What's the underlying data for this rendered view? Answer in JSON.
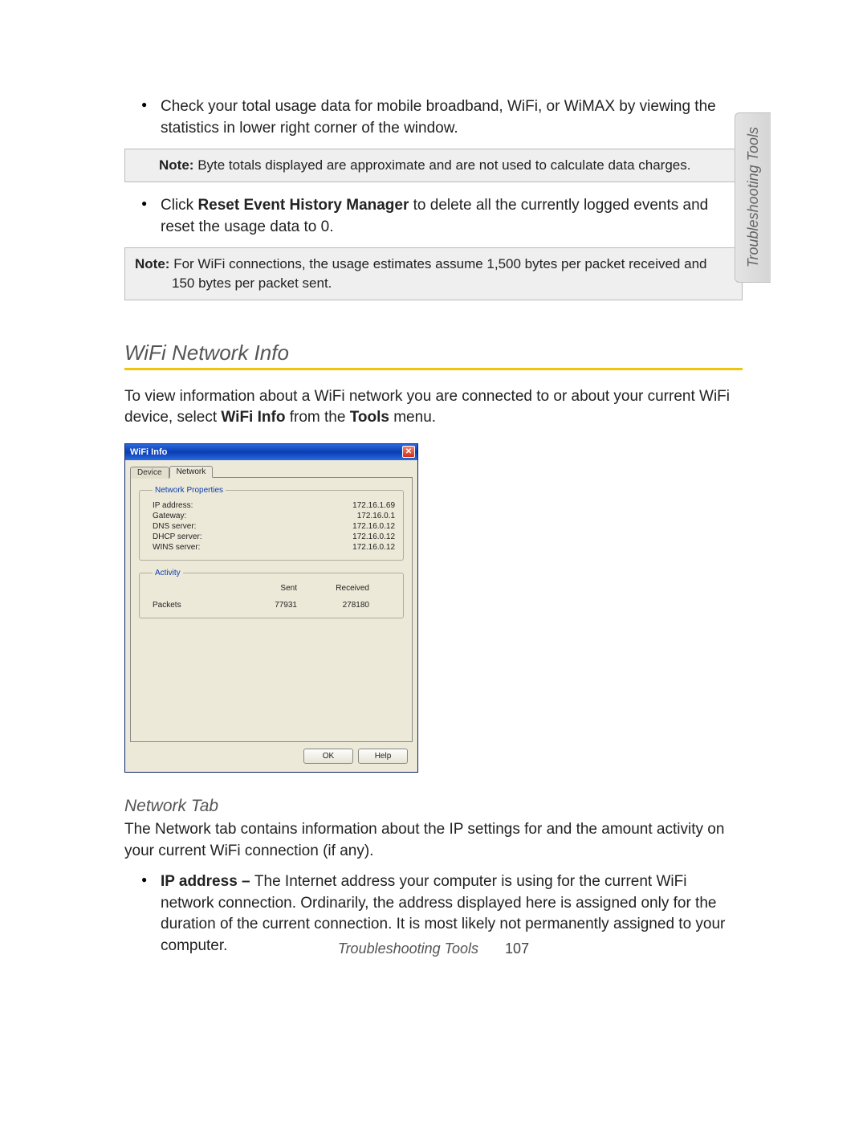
{
  "side_tab": "Troubleshooting Tools",
  "bullets_top": [
    "Check your total usage data for mobile broadband, WiFi, or WiMAX by viewing the statistics in lower right corner of the window."
  ],
  "note1": {
    "label": "Note:",
    "text": "Byte totals displayed are approximate and are not used to calculate data charges."
  },
  "bullet_click": {
    "pre": "Click ",
    "bold": "Reset Event History Manager",
    "post": " to delete all the currently logged events and reset the usage data to 0."
  },
  "note2": {
    "label": "Note:",
    "text": "For WiFi connections, the usage estimates assume 1,500 bytes per packet received and 150 bytes per packet sent."
  },
  "section_heading": "WiFi Network Info",
  "intro": {
    "pre": "To view information about a WiFi network you are connected to or about your current WiFi device, select ",
    "b1": "WiFi Info",
    "mid": " from the ",
    "b2": "Tools",
    "post": " menu."
  },
  "dialog": {
    "title": "WiFi Info",
    "tabs": {
      "device": "Device",
      "network": "Network"
    },
    "network_properties_legend": "Network Properties",
    "props": {
      "ip_label": "IP address:",
      "ip_val": "172.16.1.69",
      "gw_label": "Gateway:",
      "gw_val": "172.16.0.1",
      "dns_label": "DNS server:",
      "dns_val": "172.16.0.12",
      "dhcp_label": "DHCP server:",
      "dhcp_val": "172.16.0.12",
      "wins_label": "WINS server:",
      "wins_val": "172.16.0.12"
    },
    "activity_legend": "Activity",
    "activity": {
      "sent_header": "Sent",
      "recv_header": "Received",
      "row_label": "Packets",
      "sent_val": "77931",
      "recv_val": "278180"
    },
    "ok": "OK",
    "help": "Help"
  },
  "sub_heading": "Network Tab",
  "sub_para": "The Network tab contains information about the IP settings for and the amount activity on your current WiFi connection (if any).",
  "bullet_ip": {
    "bold": "IP address – ",
    "text": "The Internet address your computer is using for the current WiFi network connection. Ordinarily, the address displayed here is assigned only for the duration of the current connection. It is most likely not permanently assigned to your computer."
  },
  "footer": {
    "label": "Troubleshooting Tools",
    "page": "107"
  }
}
